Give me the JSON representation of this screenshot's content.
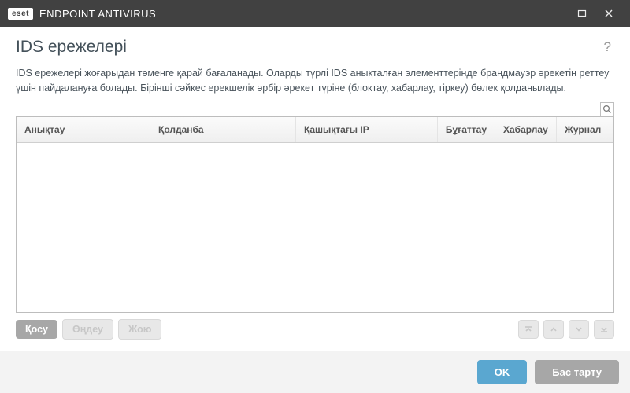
{
  "titlebar": {
    "brand_badge": "eset",
    "brand_text": "ENDPOINT ANTIVIRUS"
  },
  "heading": "IDS ережелері",
  "help_symbol": "?",
  "description": "IDS ережелері жоғарыдан төменге қарай бағаланады. Оларды түрлі IDS анықталған элементтерінде брандмауэр әрекетін реттеу үшін пайдалануға болады. Бірінші сәйкес ерекшелік әрбір әрекет түріне (блоктау, хабарлау, тіркеу) бөлек қолданылады.",
  "columns": {
    "detection": "Анықтау",
    "application": "Қолданба",
    "remote_ip": "Қашықтағы IP",
    "block": "Бұғаттау",
    "notify": "Хабарлау",
    "log": "Журнал"
  },
  "rows": [],
  "buttons": {
    "add": "Қосу",
    "edit": "Өңдеу",
    "delete": "Жою",
    "ok": "OK",
    "cancel": "Бас тарту"
  }
}
